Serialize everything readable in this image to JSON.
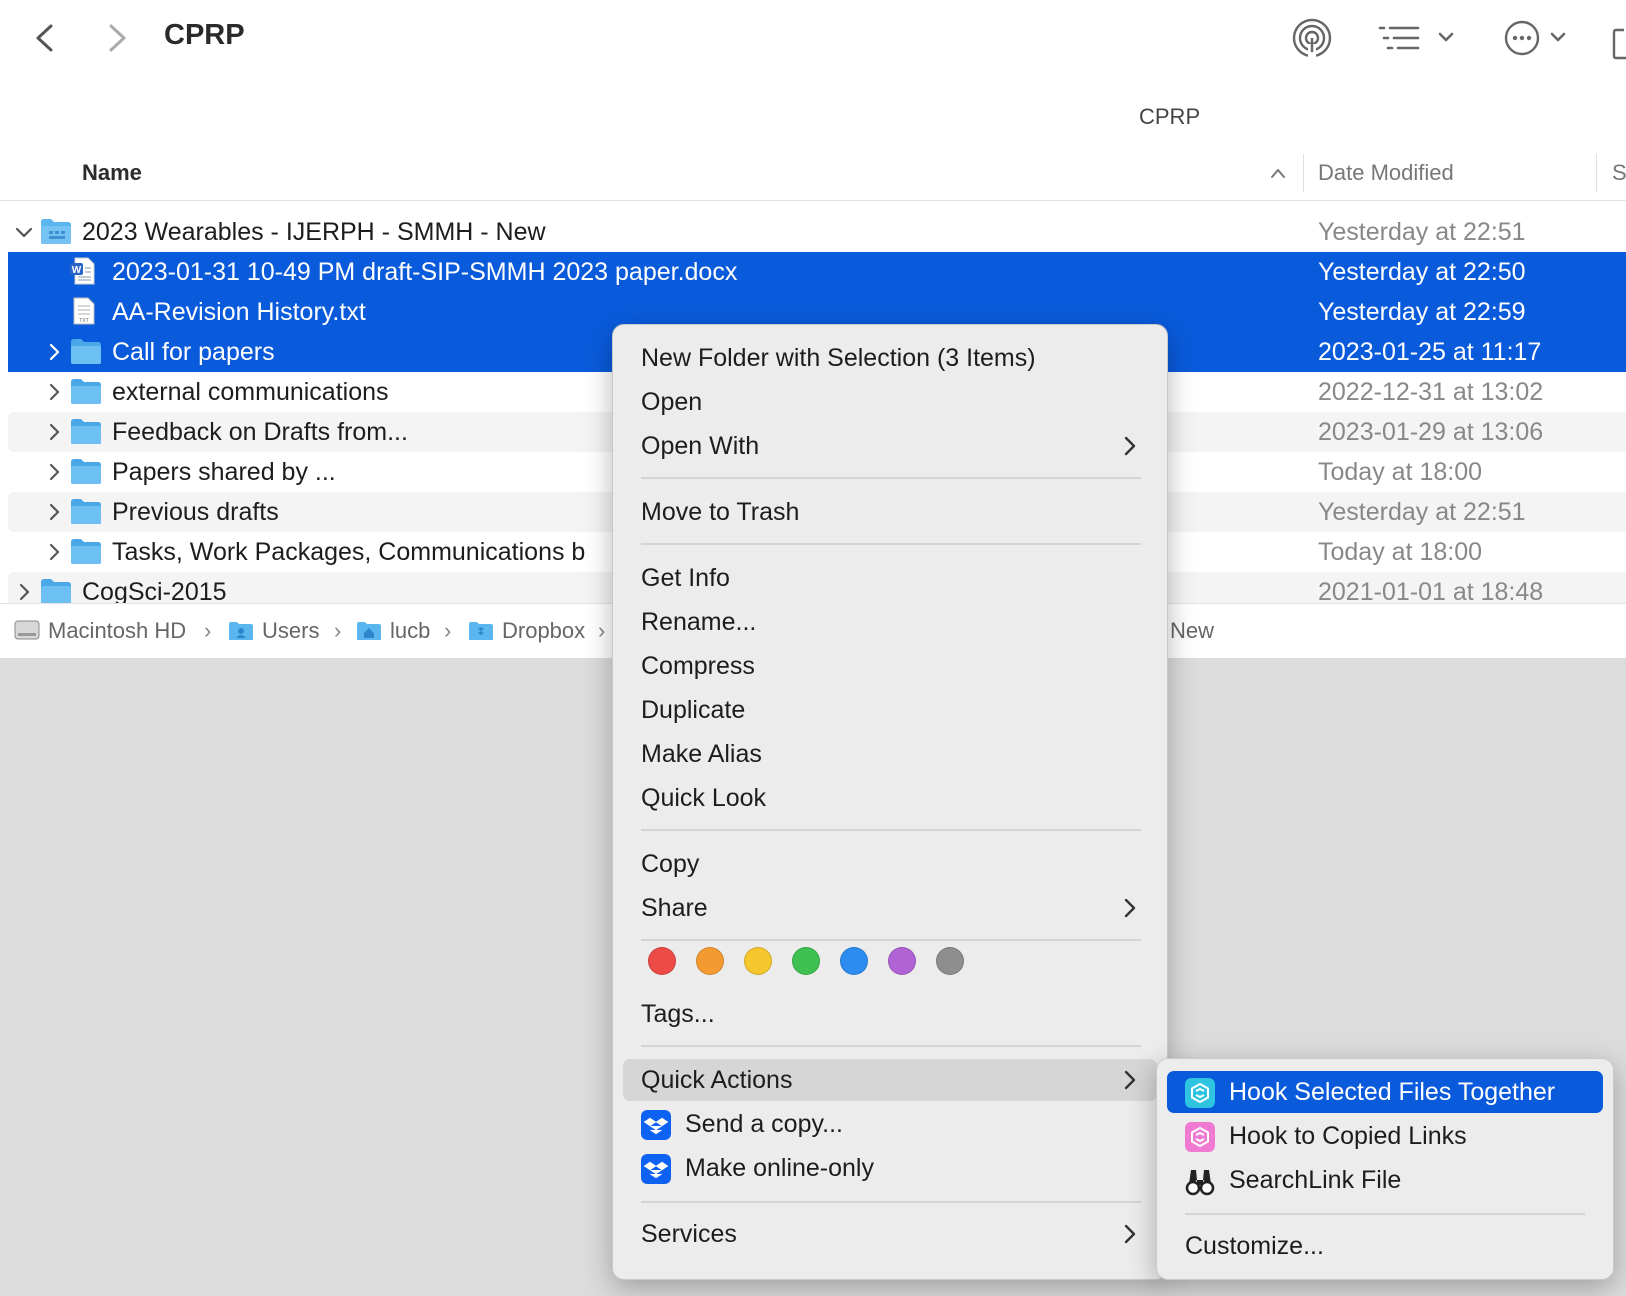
{
  "window": {
    "title": "CPRP",
    "path_title": "CPRP",
    "columns": {
      "name": "Name",
      "date": "Date Modified",
      "size": "S"
    }
  },
  "rows": [
    {
      "name": "2023 Wearables - IJERPH - SMMH - New",
      "date": "Yesterday at 22:51",
      "icon": "folder-icon"
    },
    {
      "name": "2023-01-31 10-49 PM draft-SIP-SMMH 2023 paper.docx",
      "date": "Yesterday at 22:50",
      "icon": "word-doc-icon"
    },
    {
      "name": "AA-Revision History.txt",
      "date": "Yesterday at 22:59",
      "icon": "text-file-icon"
    },
    {
      "name": "Call for papers",
      "date": "2023-01-25 at 11:17",
      "icon": "folder-icon"
    },
    {
      "name": "external communications",
      "date": "2022-12-31 at 13:02",
      "icon": "folder-icon"
    },
    {
      "name": "Feedback on Drafts from...",
      "date": "2023-01-29 at 13:06",
      "icon": "folder-icon"
    },
    {
      "name": "Papers shared by ...",
      "date": "Today at 18:00",
      "icon": "folder-icon"
    },
    {
      "name": "Previous drafts",
      "date": "Yesterday at 22:51",
      "icon": "folder-icon"
    },
    {
      "name": "Tasks, Work Packages, Communications b",
      "date": "Today at 18:00",
      "icon": "folder-icon"
    },
    {
      "name": "CogSci-2015",
      "date": "2021-01-01 at 18:48",
      "icon": "folder-icon"
    }
  ],
  "pathbar": {
    "items": [
      "Macintosh HD",
      "Users",
      "lucb",
      "Dropbox"
    ],
    "trailing": "New"
  },
  "context_menu": {
    "items": {
      "new_folder": "New Folder with Selection (3 Items)",
      "open": "Open",
      "open_with": "Open With",
      "move_to_trash": "Move to Trash",
      "get_info": "Get Info",
      "rename": "Rename...",
      "compress": "Compress",
      "duplicate": "Duplicate",
      "make_alias": "Make Alias",
      "quick_look": "Quick Look",
      "copy": "Copy",
      "share": "Share",
      "tags": "Tags...",
      "quick_actions": "Quick Actions",
      "send_copy": "Send a copy...",
      "make_online_only": "Make online-only",
      "services": "Services"
    },
    "tag_colors": [
      "#ec4b46",
      "#f39a30",
      "#f5c72c",
      "#3ec150",
      "#2d8cf0",
      "#b163d6",
      "#8e8e8e"
    ]
  },
  "submenu": {
    "items": {
      "hook_together": "Hook Selected Files Together",
      "hook_copied": "Hook to Copied Links",
      "searchlink": "SearchLink File",
      "customize": "Customize..."
    }
  },
  "colors": {
    "selection": "#0a5bdc",
    "folder": "#5bb6f0"
  }
}
